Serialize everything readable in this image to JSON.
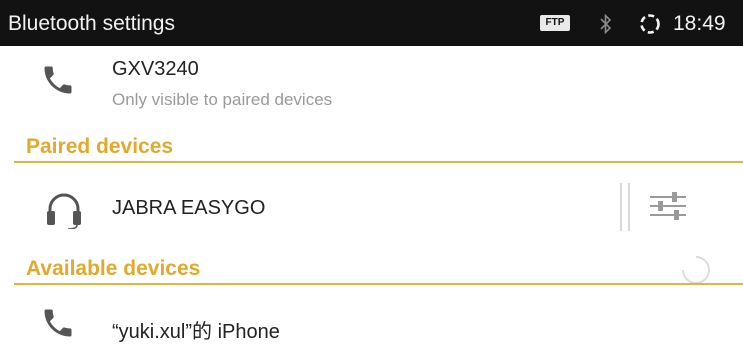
{
  "status_bar": {
    "title": "Bluetooth settings",
    "badge": "FTP",
    "time": "18:49"
  },
  "this_device": {
    "name": "GXV3240",
    "subtitle": "Only visible to paired devices"
  },
  "paired_section": {
    "title": "Paired devices",
    "devices": [
      {
        "name": "JABRA EASYGO",
        "icon": "headset-icon"
      }
    ]
  },
  "available_section": {
    "title": "Available devices",
    "devices": [
      {
        "name": "“yuki.xul”的 iPhone",
        "icon": "phone-icon"
      }
    ]
  },
  "colors": {
    "accent": "#e6a82b",
    "status_bar_bg": "#121212",
    "icon_gray": "#555555"
  }
}
